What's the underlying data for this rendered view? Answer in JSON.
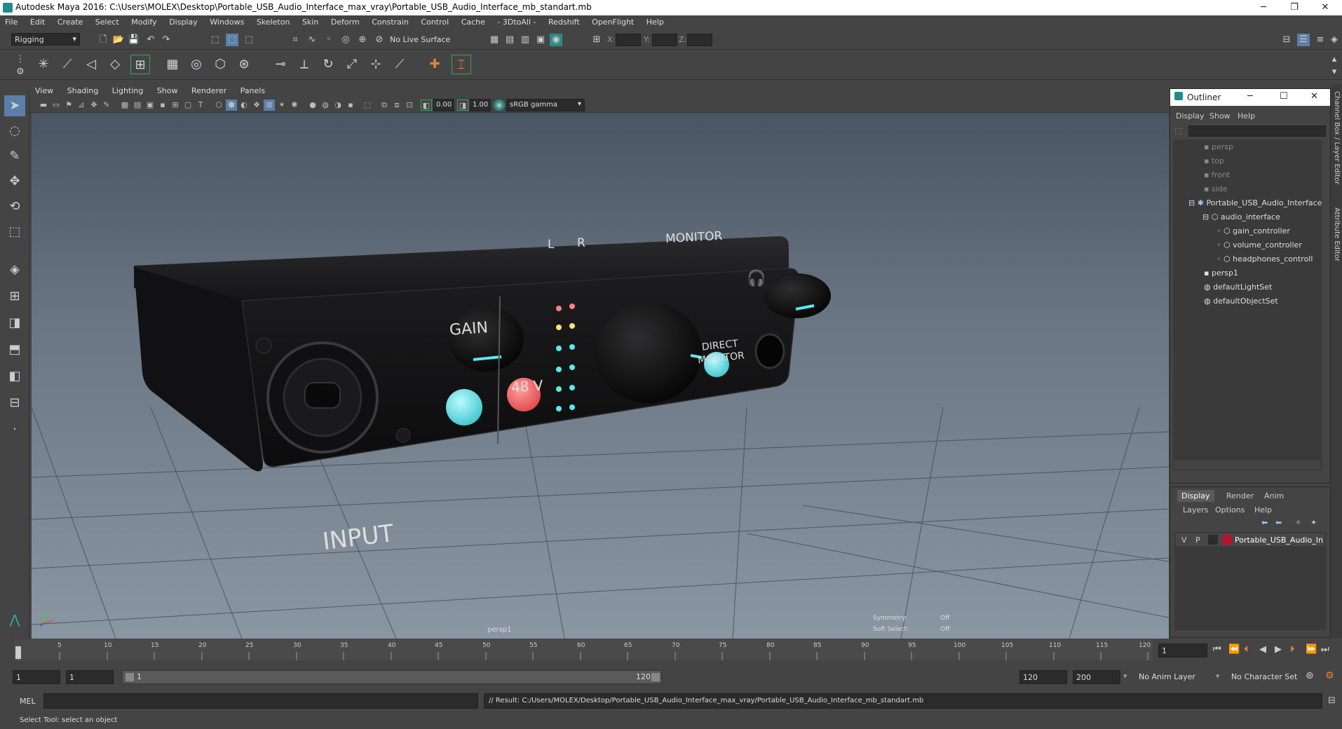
{
  "window": {
    "title": "Autodesk Maya 2016: C:\\Users\\MOLEX\\Desktop\\Portable_USB_Audio_Interface_max_vray\\Portable_USB_Audio_Interface_mb_standart.mb",
    "minimize": "─",
    "restore": "❐",
    "close": "✕"
  },
  "menubar": [
    "File",
    "Edit",
    "Create",
    "Select",
    "Modify",
    "Display",
    "Windows",
    "Skeleton",
    "Skin",
    "Deform",
    "Constrain",
    "Control",
    "Cache",
    "- 3DtoAll -",
    "Redshift",
    "OpenFlight",
    "Help"
  ],
  "statusline": {
    "menuset": "Rigging",
    "live_surface": "No Live Surface",
    "x_label": "X:",
    "y_label": "Y:",
    "z_label": "Z:"
  },
  "panel": {
    "menus": [
      "View",
      "Shading",
      "Lighting",
      "Show",
      "Renderer",
      "Panels"
    ],
    "exposure": "0.00",
    "gamma": "1.00",
    "color_space": "sRGB gamma"
  },
  "viewport": {
    "camera_label": "persp1",
    "symmetry_label": "Symmetry:",
    "symmetry_value": "Off",
    "soft_select_label": "Soft Select:",
    "soft_select_value": "Off",
    "device": {
      "input_label": "INPUT",
      "gain_label": "GAIN",
      "phantom_label": "48 V",
      "l_label": "L",
      "r_label": "R",
      "monitor_label": "MONITOR",
      "direct_label": "DIRECT",
      "monitor2_label": "MONITOR"
    }
  },
  "outliner": {
    "title": "Outliner",
    "menus": [
      "Display",
      "Show",
      "Help"
    ],
    "items": [
      {
        "label": "persp",
        "dim": true
      },
      {
        "label": "top",
        "dim": true
      },
      {
        "label": "front",
        "dim": true
      },
      {
        "label": "side",
        "dim": true
      },
      {
        "label": "Portable_USB_Audio_Interface",
        "dim": false
      },
      {
        "label": "audio_interface",
        "dim": false
      },
      {
        "label": "gain_controller",
        "dim": false
      },
      {
        "label": "volume_controller",
        "dim": false
      },
      {
        "label": "headphones_controll",
        "dim": false
      },
      {
        "label": "persp1",
        "dim": false
      },
      {
        "label": "defaultLightSet",
        "dim": false
      },
      {
        "label": "defaultObjectSet",
        "dim": false
      }
    ]
  },
  "layers": {
    "tabs": [
      "Display",
      "Render",
      "Anim"
    ],
    "menus": [
      "Layers",
      "Options",
      "Help"
    ],
    "row": {
      "v": "V",
      "p": "P",
      "name": "Portable_USB_Audio_In",
      "color": "#b3142c"
    }
  },
  "right_tabs": {
    "channel_box": "Channel Box / Layer Editor",
    "attribute_editor": "Attribute Editor"
  },
  "timeline": {
    "ticks": [
      "1",
      "5",
      "10",
      "15",
      "20",
      "25",
      "30",
      "35",
      "40",
      "45",
      "50",
      "55",
      "60",
      "65",
      "70",
      "75",
      "80",
      "85",
      "90",
      "95",
      "100",
      "105",
      "110",
      "115",
      "120"
    ],
    "current_frame": "1"
  },
  "range": {
    "start": "1",
    "start2": "1",
    "slider_start": "1",
    "slider_end": "120",
    "end": "120",
    "end2": "200",
    "anim_layer": "No Anim Layer",
    "char_set": "No Character Set"
  },
  "cmdline": {
    "lang": "MEL",
    "result": "// Result: C:/Users/MOLEX/Desktop/Portable_USB_Audio_Interface_max_vray/Portable_USB_Audio_Interface_mb_standart.mb"
  },
  "helpline": {
    "text": "Select Tool: select an object"
  },
  "colors": {
    "accent": "#5ce8f0",
    "phantom_red": "#f06060",
    "layer_red": "#b3142c"
  }
}
